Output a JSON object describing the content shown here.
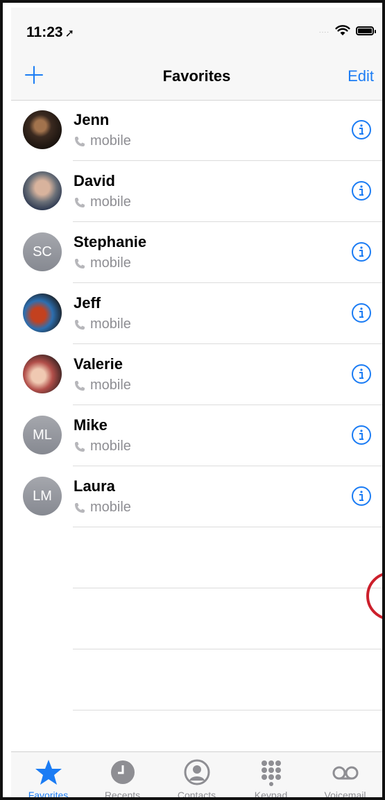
{
  "status": {
    "time": "11:23",
    "location_glyph": "➚",
    "signal": "....",
    "wifi_icon": "wifi-icon",
    "battery_icon": "battery-icon"
  },
  "nav": {
    "title": "Favorites",
    "add_icon": "plus-icon",
    "edit_label": "Edit"
  },
  "favorites": [
    {
      "name": "Jenn",
      "label": "mobile",
      "avatar_type": "photo"
    },
    {
      "name": "David",
      "label": "mobile",
      "avatar_type": "photo"
    },
    {
      "name": "Stephanie",
      "label": "mobile",
      "avatar_type": "initials",
      "initials": "SC"
    },
    {
      "name": "Jeff",
      "label": "mobile",
      "avatar_type": "photo"
    },
    {
      "name": "Valerie",
      "label": "mobile",
      "avatar_type": "photo"
    },
    {
      "name": "Mike",
      "label": "mobile",
      "avatar_type": "initials",
      "initials": "ML"
    },
    {
      "name": "Laura",
      "label": "mobile",
      "avatar_type": "initials",
      "initials": "LM"
    }
  ],
  "tabbar": {
    "tabs": [
      {
        "label": "Favorites",
        "icon": "star-icon",
        "active": true
      },
      {
        "label": "Recents",
        "icon": "clock-icon",
        "active": false
      },
      {
        "label": "Contacts",
        "icon": "person-circle-icon",
        "active": false
      },
      {
        "label": "Keypad",
        "icon": "keypad-icon",
        "active": false
      },
      {
        "label": "Voicemail",
        "icon": "voicemail-icon",
        "active": false
      }
    ]
  },
  "colors": {
    "accent": "#1b7cf4",
    "secondary_text": "#8e8e93",
    "annotation_red": "#cc1f2b"
  }
}
